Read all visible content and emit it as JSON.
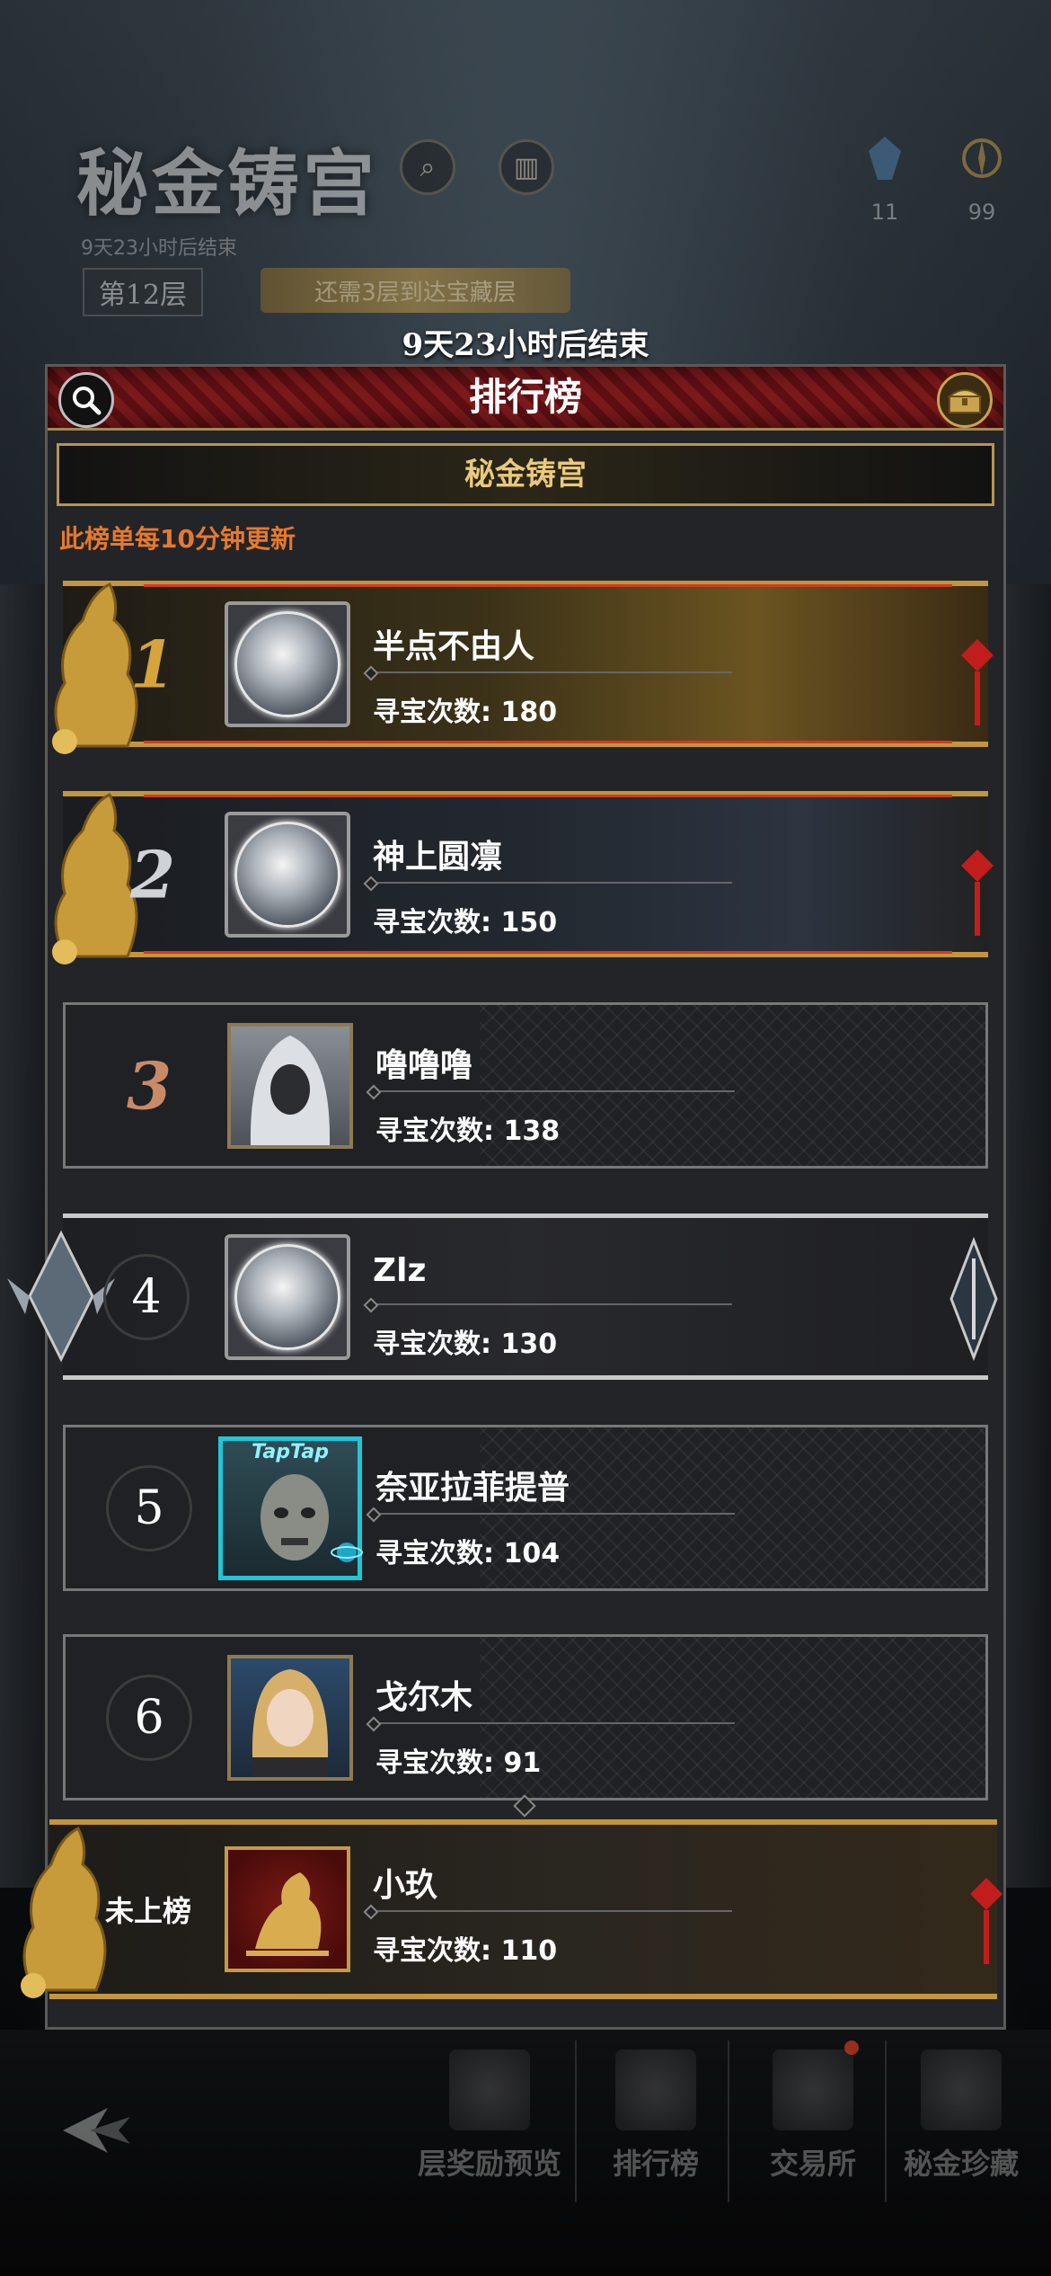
{
  "header": {
    "map_title": "秘金铸宫",
    "ends_in_small": "9天23小时后结束",
    "floor": "第12层",
    "task": "还需3层到达宝藏层",
    "resource_1": "11",
    "resource_2": "99"
  },
  "timer": "9天23小时后结束",
  "panel": {
    "title": "排行榜",
    "tab_label": "秘金铸宫",
    "update_note": "此榜单每10分钟更新"
  },
  "rows": [
    {
      "rank": "1",
      "name": "半点不由人",
      "count_label": "寻宝次数:",
      "count": "180",
      "avatar": "castle-emblem"
    },
    {
      "rank": "2",
      "name": "神上圆凛",
      "count_label": "寻宝次数:",
      "count": "150",
      "avatar": "castle-emblem"
    },
    {
      "rank": "3",
      "name": "噜噜噜",
      "count_label": "寻宝次数:",
      "count": "138",
      "avatar": "hooded-figure"
    },
    {
      "rank": "4",
      "name": "Zlz",
      "count_label": "寻宝次数:",
      "count": "130",
      "avatar": "castle-emblem"
    },
    {
      "rank": "5",
      "name": "奈亚拉菲提普",
      "count_label": "寻宝次数:",
      "count": "104",
      "avatar": "skull-face",
      "avatar_frame_text": "TapTap"
    },
    {
      "rank": "6",
      "name": "戈尔木",
      "count_label": "寻宝次数:",
      "count": "91",
      "avatar": "blonde-girl"
    }
  ],
  "my_row": {
    "rank": "未上榜",
    "name": "小玖",
    "count_label": "寻宝次数:",
    "count": "110",
    "avatar": "golden-horse"
  },
  "bottom_nav": [
    {
      "label": "层奖励预览"
    },
    {
      "label": "排行榜"
    },
    {
      "label": "交易所"
    },
    {
      "label": "秘金珍藏"
    }
  ],
  "colors": {
    "accent_gold": "#c4953b",
    "update_note": "#e67a2c",
    "header_red": "#7c1a1c",
    "rank1_gold": "#d6a43a",
    "rank2_silver": "#cfd3d8",
    "rank3_bronze": "#c98a68"
  }
}
